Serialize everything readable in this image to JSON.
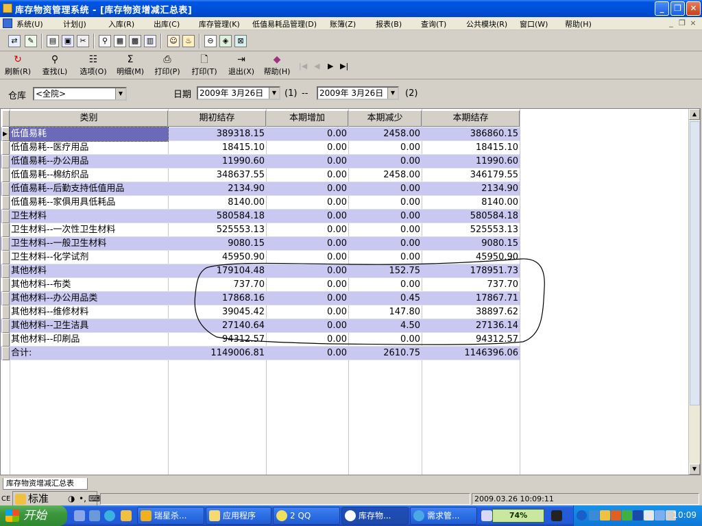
{
  "window": {
    "title": "库存物资管理系统 - [库存物资增减汇总表]"
  },
  "menubar": {
    "items": [
      "系统(U)",
      "计划(J)",
      "入库(R)",
      "出库(C)",
      "库存管理(K)",
      "低值易耗品管理(D)",
      "账簿(Z)",
      "报表(B)",
      "查询(T)",
      "公共模块(R)",
      "窗口(W)",
      "帮助(H)"
    ]
  },
  "toolbar2": {
    "refresh": "刷新(R)",
    "find": "查找(L)",
    "options": "选项(O)",
    "detail": "明细(M)",
    "print1": "打印(P)",
    "print2": "打印(T)",
    "exit": "退出(X)",
    "help": "帮助(H)"
  },
  "filter": {
    "warehouse_label": "仓库",
    "warehouse_value": "<全院>",
    "date_label": "日期",
    "date_from": "2009年 3月26日",
    "date_to": "2009年 3月26日",
    "link1": "(1)",
    "dash": "--",
    "link2": "(2)"
  },
  "table": {
    "columns": [
      "类别",
      "期初结存",
      "本期增加",
      "本期减少",
      "本期结存"
    ],
    "rows": [
      [
        "低值易耗",
        "389318.15",
        "0.00",
        "2458.00",
        "386860.15"
      ],
      [
        "低值易耗--医疗用品",
        "18415.10",
        "0.00",
        "0.00",
        "18415.10"
      ],
      [
        "低值易耗--办公用品",
        "11990.60",
        "0.00",
        "0.00",
        "11990.60"
      ],
      [
        "低值易耗--棉纺织品",
        "348637.55",
        "0.00",
        "2458.00",
        "346179.55"
      ],
      [
        "低值易耗--后勤支持低值用品",
        "2134.90",
        "0.00",
        "0.00",
        "2134.90"
      ],
      [
        "低值易耗--家俱用具低耗品",
        "8140.00",
        "0.00",
        "0.00",
        "8140.00"
      ],
      [
        "卫生材料",
        "580584.18",
        "0.00",
        "0.00",
        "580584.18"
      ],
      [
        "卫生材料--一次性卫生材料",
        "525553.13",
        "0.00",
        "0.00",
        "525553.13"
      ],
      [
        "卫生材料--一般卫生材料",
        "9080.15",
        "0.00",
        "0.00",
        "9080.15"
      ],
      [
        "卫生材料--化学试剂",
        "45950.90",
        "0.00",
        "0.00",
        "45950.90"
      ],
      [
        "其他材料",
        "179104.48",
        "0.00",
        "152.75",
        "178951.73"
      ],
      [
        "其他材料--布类",
        "737.70",
        "0.00",
        "0.00",
        "737.70"
      ],
      [
        "其他材料--办公用品类",
        "17868.16",
        "0.00",
        "0.45",
        "17867.71"
      ],
      [
        "其他材料--维修材料",
        "39045.42",
        "0.00",
        "147.80",
        "38897.62"
      ],
      [
        "其他材料--卫生洁具",
        "27140.64",
        "0.00",
        "4.50",
        "27136.14"
      ],
      [
        "其他材料--印刷品",
        "94312.57",
        "0.00",
        "0.00",
        "94312.57"
      ],
      [
        "合计:",
        "1149006.81",
        "0.00",
        "2610.75",
        "1146396.06"
      ]
    ]
  },
  "tabs": {
    "active": "库存物资增减汇总表"
  },
  "statusbar": {
    "datetime": "2009.03.26 10:09:11",
    "ime_label": "标准",
    "ime_prefix": "CE"
  },
  "taskbar": {
    "start": "开始",
    "tasks": [
      "瑞星杀...",
      "应用程序",
      "2 QQ",
      "库存物...",
      "需求管..."
    ],
    "battery": "74%",
    "clock": "10:09"
  },
  "colors": {
    "row_highlight": "#c8c8f0",
    "title_blue": "#0054e3",
    "annotation": "#000000"
  }
}
